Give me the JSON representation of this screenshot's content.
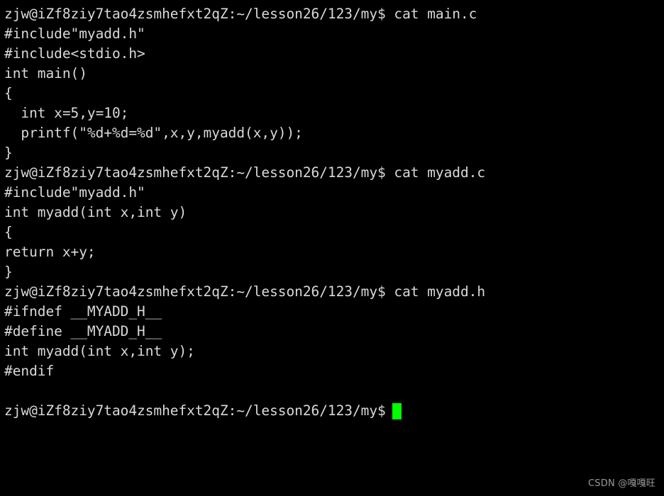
{
  "terminal": {
    "background_color": "#000000",
    "text_color": "#d9d9d9",
    "cursor_color": "#00ff00",
    "prompt": "zjw@iZf8ziy7tao4zsmhefxt2qZ:~/lesson26/123/my$ ",
    "user": "zjw",
    "host": "iZf8ziy7tao4zsmhefxt2qZ",
    "cwd": "~/lesson26/123/my",
    "lines": [
      {
        "type": "prompt",
        "text": "zjw@iZf8ziy7tao4zsmhefxt2qZ:~/lesson26/123/my$ cat main.c"
      },
      {
        "type": "output",
        "text": "#include\"myadd.h\""
      },
      {
        "type": "output",
        "text": "#include<stdio.h>"
      },
      {
        "type": "output",
        "text": "int main()"
      },
      {
        "type": "output",
        "text": "{"
      },
      {
        "type": "output",
        "text": "  int x=5,y=10;"
      },
      {
        "type": "output",
        "text": "  printf(\"%d+%d=%d\",x,y,myadd(x,y));"
      },
      {
        "type": "output",
        "text": "}"
      },
      {
        "type": "prompt",
        "text": "zjw@iZf8ziy7tao4zsmhefxt2qZ:~/lesson26/123/my$ cat myadd.c"
      },
      {
        "type": "output",
        "text": "#include\"myadd.h\""
      },
      {
        "type": "output",
        "text": "int myadd(int x,int y)"
      },
      {
        "type": "output",
        "text": "{"
      },
      {
        "type": "output",
        "text": "return x+y;"
      },
      {
        "type": "output",
        "text": "}"
      },
      {
        "type": "prompt",
        "text": "zjw@iZf8ziy7tao4zsmhefxt2qZ:~/lesson26/123/my$ cat myadd.h"
      },
      {
        "type": "output",
        "text": "#ifndef __MYADD_H__"
      },
      {
        "type": "output",
        "text": "#define __MYADD_H__"
      },
      {
        "type": "output",
        "text": "int myadd(int x,int y);"
      },
      {
        "type": "output",
        "text": "#endif"
      },
      {
        "type": "blank",
        "text": " "
      }
    ],
    "current_prompt": "zjw@iZf8ziy7tao4zsmhefxt2qZ:~/lesson26/123/my$",
    "commands": [
      "cat main.c",
      "cat myadd.c",
      "cat myadd.h"
    ]
  },
  "watermark": {
    "text": "CSDN @嘎嘎旺"
  }
}
